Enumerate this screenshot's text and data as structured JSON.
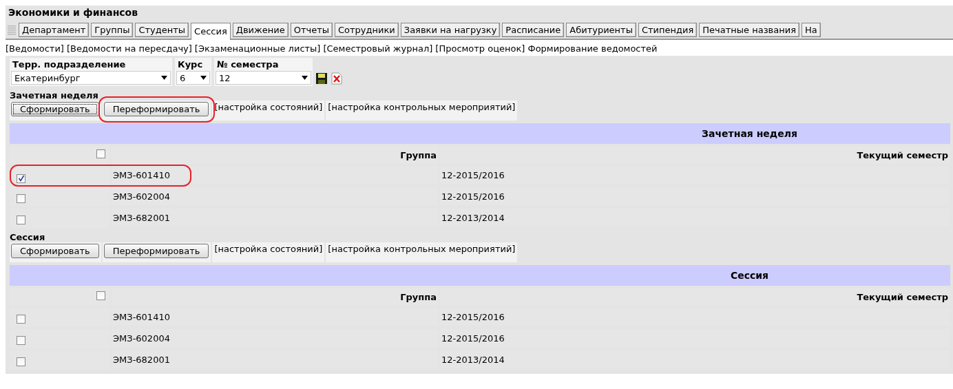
{
  "title": "Экономики и финансов",
  "tabs": [
    {
      "label": "Департамент",
      "selected": false
    },
    {
      "label": "Группы",
      "selected": false
    },
    {
      "label": "Студенты",
      "selected": false
    },
    {
      "label": "Сессия",
      "selected": true
    },
    {
      "label": "Движение",
      "selected": false
    },
    {
      "label": "Отчеты",
      "selected": false
    },
    {
      "label": "Сотрудники",
      "selected": false
    },
    {
      "label": "Заявки на нагрузку",
      "selected": false
    },
    {
      "label": "Расписание",
      "selected": false
    },
    {
      "label": "Абитуриенты",
      "selected": false
    },
    {
      "label": "Стипендия",
      "selected": false
    },
    {
      "label": "Печатные названия",
      "selected": false
    },
    {
      "label": "На",
      "selected": false
    }
  ],
  "sublinks": [
    "[Ведомости]",
    "[Ведомости на пересдачу]",
    "[Экзаменационные листы]",
    "[Семестровый журнал]",
    "[Просмотр оценок]",
    "Формирование ведомостей"
  ],
  "filters": [
    {
      "label": "Терр. подразделение",
      "value": "Екатеринбург"
    },
    {
      "label": "Курс",
      "value": "6"
    },
    {
      "label": "№ семестра",
      "value": "12"
    }
  ],
  "sections": [
    {
      "label": "Зачетная неделя",
      "buttons": [
        {
          "label": "Сформировать",
          "focused": true,
          "highlighted": false
        },
        {
          "label": "Переформировать",
          "focused": false,
          "highlighted": true
        }
      ],
      "links": [
        "[настройка состояний]",
        "[настройка контрольных мероприятий]"
      ],
      "table_title": "Зачетная неделя",
      "columns": [
        "Группа",
        "Текущий семестр"
      ],
      "all_checked": false,
      "rows": [
        {
          "checked": true,
          "highlighted": true,
          "group": "ЭМЗ-601410",
          "semester": "12-2015/2016"
        },
        {
          "checked": false,
          "highlighted": false,
          "group": "ЭМЗ-602004",
          "semester": "12-2015/2016"
        },
        {
          "checked": false,
          "highlighted": false,
          "group": "ЭМЗ-682001",
          "semester": "12-2013/2014"
        }
      ]
    },
    {
      "label": "Сессия",
      "buttons": [
        {
          "label": "Сформировать",
          "focused": false,
          "highlighted": false
        },
        {
          "label": "Переформировать",
          "focused": false,
          "highlighted": false
        }
      ],
      "links": [
        "[настройка состояний]",
        "[настройка контрольных мероприятий]"
      ],
      "table_title": "Сессия",
      "columns": [
        "Группа",
        "Текущий семестр"
      ],
      "all_checked": false,
      "rows": [
        {
          "checked": false,
          "highlighted": false,
          "group": "ЭМЗ-601410",
          "semester": "12-2015/2016"
        },
        {
          "checked": false,
          "highlighted": false,
          "group": "ЭМЗ-602004",
          "semester": "12-2015/2016"
        },
        {
          "checked": false,
          "highlighted": false,
          "group": "ЭМЗ-682001",
          "semester": "12-2013/2014"
        }
      ]
    }
  ]
}
